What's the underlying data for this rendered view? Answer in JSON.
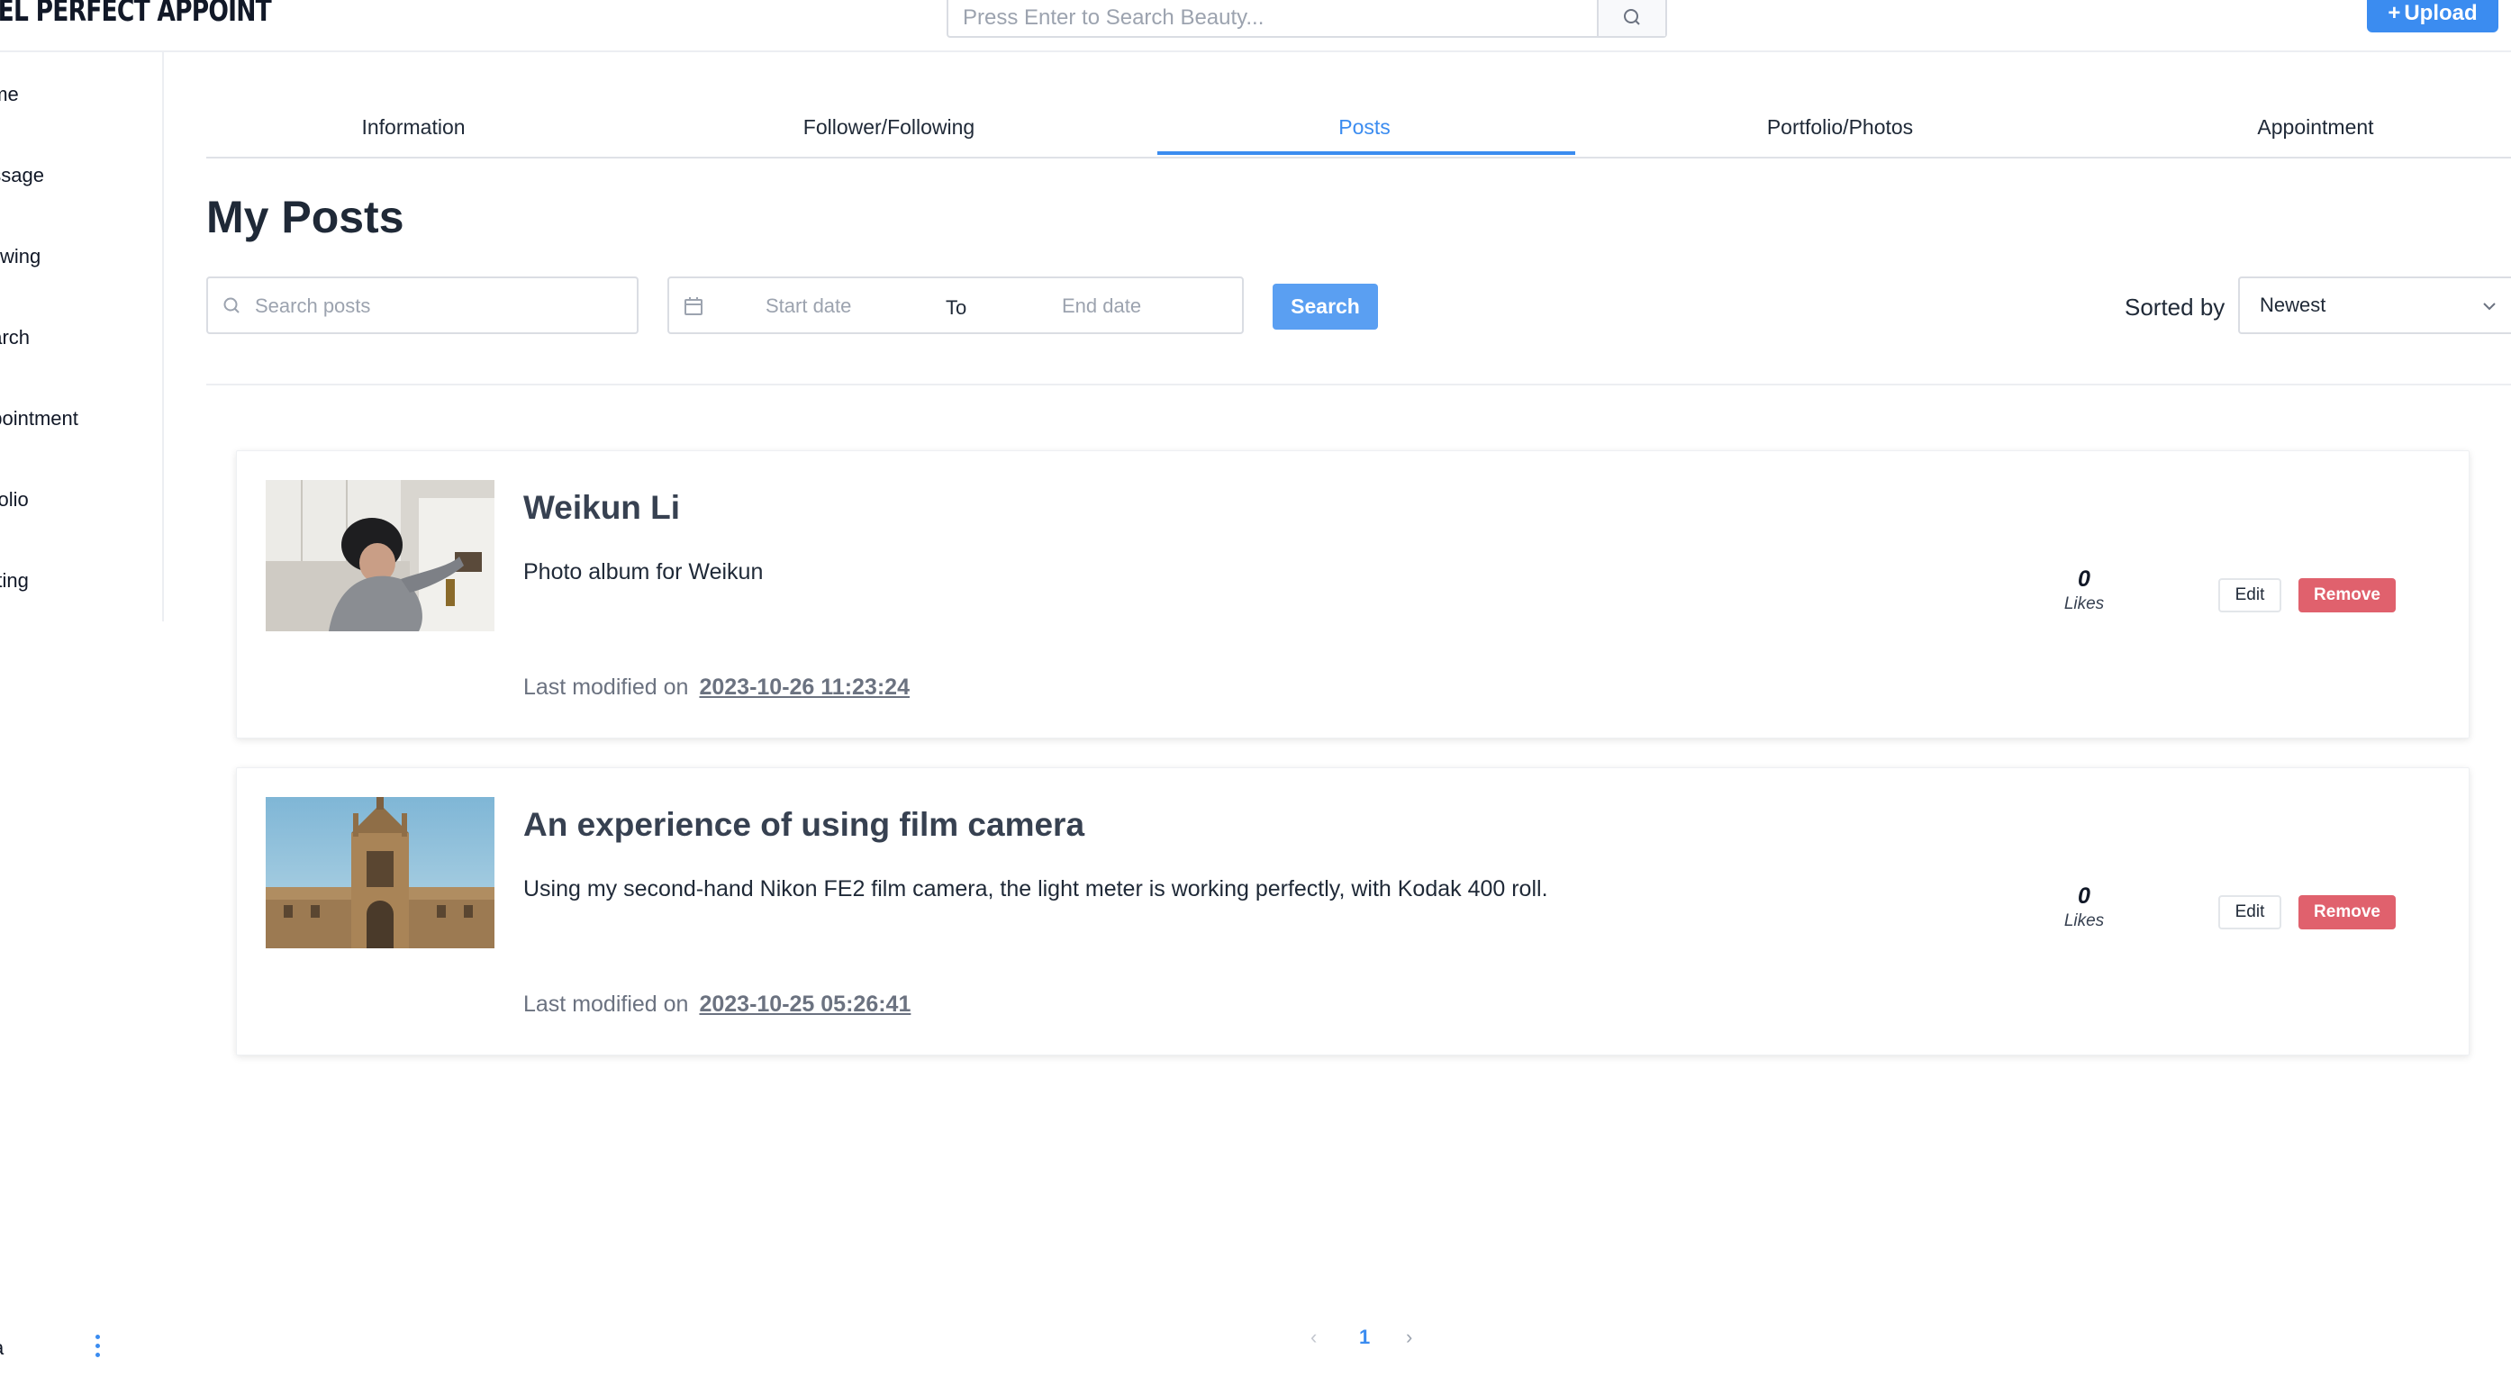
{
  "header": {
    "logo_text": "XEL PERFECT APPOINT",
    "search_placeholder": "Press Enter to Search Beauty...",
    "upload_label": "Upload"
  },
  "sidebar": {
    "items": [
      {
        "label": "ome"
      },
      {
        "label": "essage"
      },
      {
        "label": "llowing"
      },
      {
        "label": "earch"
      },
      {
        "label": "ppointment"
      },
      {
        "label": "rtfolio"
      },
      {
        "label": "etting"
      }
    ],
    "user_label": "a"
  },
  "tabs": [
    {
      "label": "Information"
    },
    {
      "label": "Follower/Following"
    },
    {
      "label": "Posts",
      "active": true
    },
    {
      "label": "Portfolio/Photos"
    },
    {
      "label": "Appointment"
    }
  ],
  "main": {
    "title": "My Posts",
    "search_placeholder": "Search posts",
    "start_date_placeholder": "Start date",
    "to_label": "To",
    "end_date_placeholder": "End date",
    "search_button": "Search",
    "sorted_by_label": "Sorted by",
    "sort_value": "Newest"
  },
  "posts": [
    {
      "title": "Weikun Li",
      "description": "Photo album for Weikun",
      "modified_label": "Last modified on",
      "modified_date": "2023-10-26 11:23:24",
      "likes": "0",
      "likes_label": "Likes",
      "edit_label": "Edit",
      "remove_label": "Remove"
    },
    {
      "title": "An experience of using film camera",
      "description": "Using my second-hand Nikon FE2 film camera, the light meter is working perfectly, with Kodak 400 roll.",
      "modified_label": "Last modified on",
      "modified_date": "2023-10-25 05:26:41",
      "likes": "0",
      "likes_label": "Likes",
      "edit_label": "Edit",
      "remove_label": "Remove"
    }
  ],
  "pagination": {
    "current": "1",
    "prev_icon": "chevron-left-icon",
    "next_icon": "chevron-right-icon"
  },
  "colors": {
    "accent": "#3b8cf0",
    "danger": "#e0616d"
  }
}
